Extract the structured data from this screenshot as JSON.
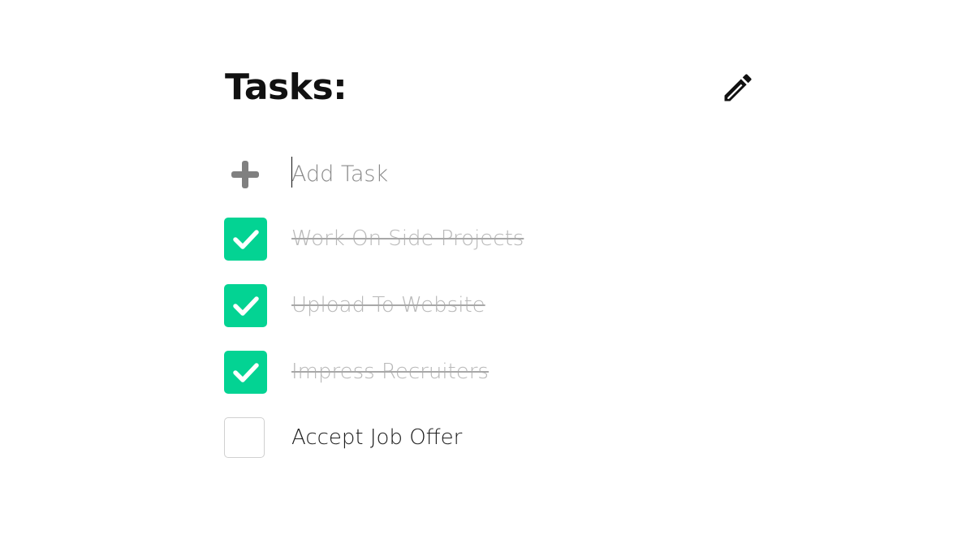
{
  "header": {
    "title": "Tasks:",
    "edit_icon": "pencil-icon"
  },
  "add_task": {
    "icon": "plus-icon",
    "placeholder": "Add Task",
    "value": ""
  },
  "colors": {
    "accent": "#03d393",
    "done_text": "#b8b8b8",
    "placeholder": "#8a8a8a",
    "plus_icon": "#808080"
  },
  "tasks": [
    {
      "label": "Work On Side Projects",
      "completed": true
    },
    {
      "label": "Upload To Website",
      "completed": true
    },
    {
      "label": "Impress Recruiters",
      "completed": true
    },
    {
      "label": "Accept Job Offer",
      "completed": false
    }
  ]
}
